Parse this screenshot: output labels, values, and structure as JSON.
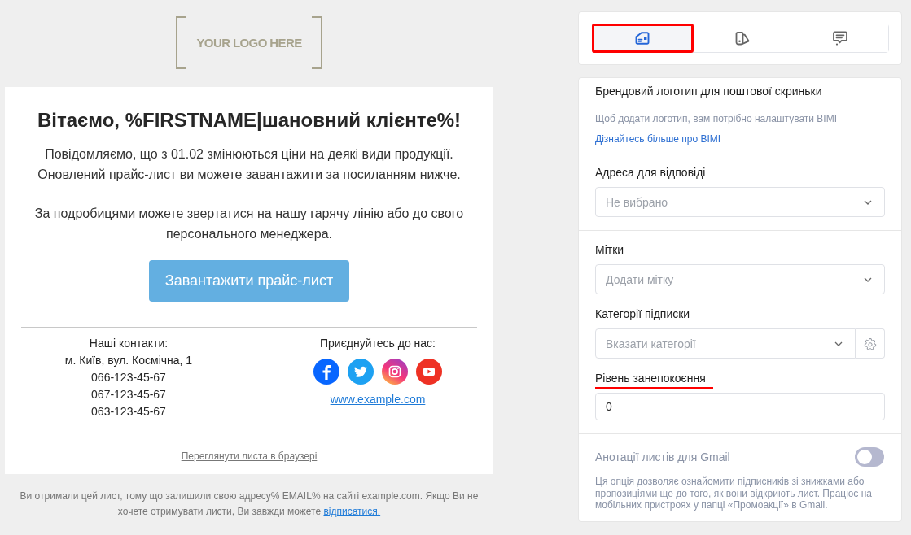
{
  "email_preview": {
    "logo": "YOUR LOGO HERE",
    "heading": "Вітаємо, %FIRSTNAME|шановний клієнте%!",
    "paragraphs": [
      "Повідомляємо, що з 01.02 змінюються ціни на деякі види продукції. Оновлений прайс-лист ви можете завантажити за посиланням нижче.",
      "За подробицями можете звертатися на нашу гарячу лінію або до свого персонального менеджера."
    ],
    "cta_button": "Завантажити прайс-лист",
    "contacts": {
      "title": "Наші контакти:",
      "lines": [
        "м. Київ, вул. Космічна, 1",
        "066-123-45-67",
        "067-123-45-67",
        "063-123-45-67"
      ]
    },
    "social": {
      "title": "Приєднуйтесь до нас:",
      "networks": [
        {
          "kind": "facebook"
        },
        {
          "kind": "twitter"
        },
        {
          "kind": "instagram"
        },
        {
          "kind": "youtube"
        }
      ],
      "website": "www.example.com"
    },
    "view_in_browser": "Переглянути листа в браузері",
    "footer": {
      "text": "Ви отримали цей лист, тому що залишили свою адресу% EMAIL% на сайті example.com. Якщо Ви не хочете отримувати листи, Ви завжди можете",
      "unsubscribe_link": "відписатися."
    }
  },
  "settings": {
    "tabs": [
      {
        "kind": "letter",
        "selected": true,
        "highlighted": true
      },
      {
        "kind": "swatches",
        "selected": false,
        "highlighted": false
      },
      {
        "kind": "chat",
        "selected": false,
        "highlighted": false
      }
    ],
    "bimi": {
      "title": "Брендовий логотип для поштової скриньки",
      "hint": "Щоб додати логотип, вам потрібно налаштувати BIMI",
      "link": "Дізнайтесь більше про BIMI"
    },
    "reply_address": {
      "label": "Адреса для відповіді",
      "placeholder": "Не вибрано"
    },
    "tags": {
      "label": "Мітки",
      "placeholder": "Додати мітку"
    },
    "subscription_categories": {
      "label": "Категорії підписки",
      "placeholder": "Вказати категорії"
    },
    "concern_level": {
      "label": "Рівень занепокоєння",
      "value": "0",
      "highlighted": true
    },
    "gmail_annotations": {
      "label": "Анотації листів для Gmail",
      "on": false,
      "description": "Ця опція дозволяє ознайомити підписників зі знижками або пропозиціями ще до того, як вони відкриють лист. Працює на мобільних пристроях у папці «Промоакції» в Gmail."
    }
  }
}
